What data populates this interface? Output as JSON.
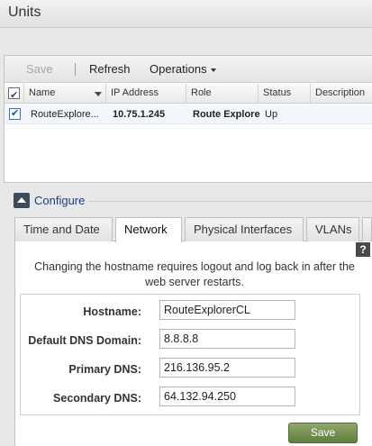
{
  "window": {
    "title": "Units"
  },
  "toolbar": {
    "save_label": "Save",
    "refresh_label": "Refresh",
    "operations_label": "Operations"
  },
  "grid": {
    "columns": [
      "Name",
      "IP Address",
      "Role",
      "Status",
      "Description"
    ],
    "rows": [
      {
        "checked": true,
        "name": "RouteExplore...",
        "ip": "10.75.1.245",
        "role": "Route Explore",
        "status": "Up",
        "description": ""
      }
    ]
  },
  "configure": {
    "label": "Configure"
  },
  "tabs": [
    {
      "label": "Time and Date",
      "active": false
    },
    {
      "label": "Network",
      "active": true
    },
    {
      "label": "Physical Interfaces",
      "active": false
    },
    {
      "label": "VLANs",
      "active": false
    }
  ],
  "help": {
    "glyph": "?"
  },
  "network": {
    "notice": "Changing the hostname requires logout and log back in after the web server restarts.",
    "fields": {
      "hostname": {
        "label": "Hostname:",
        "value": "RouteExplorerCL"
      },
      "dns_domain": {
        "label": "Default DNS Domain:",
        "value": "8.8.8.8"
      },
      "primary_dns": {
        "label": "Primary DNS:",
        "value": "216.136.95.2"
      },
      "secondary_dns": {
        "label": "Secondary DNS:",
        "value": "64.132.94.250"
      }
    },
    "save_label": "Save"
  },
  "icons": {
    "collapse": "triangle-up-icon",
    "help": "question-icon",
    "checkbox": "checkmark-icon"
  },
  "colors": {
    "accent": "#1f3f7a",
    "save_button": "#6f8c4c",
    "toolbar_disabled": "#a6a6a6"
  }
}
